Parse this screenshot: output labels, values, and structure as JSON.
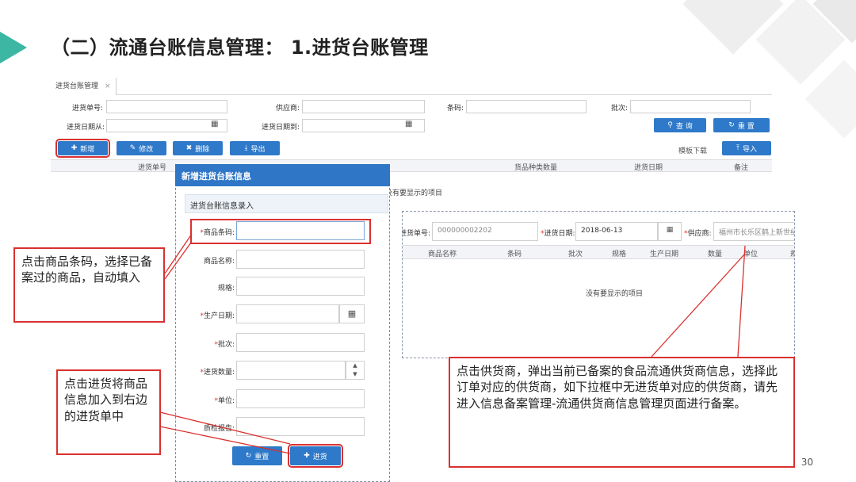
{
  "slide": {
    "title": "（二）流通台账信息管理： 1.进货台账管理",
    "page_number": "30"
  },
  "tab": {
    "label": "进货台账管理",
    "close": "×"
  },
  "search_form": {
    "order_no_label": "进货单号:",
    "supplier_label": "供应商:",
    "barcode_label": "条码:",
    "batch_label": "批次:",
    "date_from_label": "进货日期从:",
    "date_to_label": "进货日期到:",
    "query_button": "查 询",
    "reset_button": "重 置"
  },
  "toolbar": {
    "add": "新增",
    "edit": "修改",
    "delete": "删除",
    "export": "导出",
    "template_download": "模板下载",
    "import": "导入"
  },
  "grid": {
    "columns": [
      "进货单号",
      "货品种类数量",
      "进货日期",
      "备注"
    ],
    "empty_message": "没有要显示的项目"
  },
  "modal": {
    "title": "新增进货台账信息",
    "section_title": "进货台账信息录入",
    "fields": [
      {
        "label": "商品条码:",
        "required": "*"
      },
      {
        "label": "商品名称:",
        "required": ""
      },
      {
        "label": "规格:",
        "required": ""
      },
      {
        "label": "生产日期:",
        "required": "*"
      },
      {
        "label": "批次:",
        "required": "*"
      },
      {
        "label": "进货数量:",
        "required": "*"
      },
      {
        "label": "单位:",
        "required": "*"
      },
      {
        "label": "质检报告:",
        "required": ""
      }
    ],
    "reset_button": "重置",
    "submit_button": "进货"
  },
  "order_panel": {
    "order_no_label": "进货单号:",
    "order_no_value": "000000002202",
    "date_label": "进货日期:",
    "date_required": "*",
    "date_value": "2018-06-13",
    "supplier_label": "供应商:",
    "supplier_required": "*",
    "supplier_value": "福州市长乐区鹤上新世纪",
    "columns": [
      "商品名称",
      "条码",
      "批次",
      "规格",
      "生产日期",
      "数量",
      "单位",
      "规"
    ],
    "empty_message": "没有要显示的项目"
  },
  "callouts": {
    "barcode": "点击商品条码，选择已备案过的商品，自动填入",
    "submit": "点击进货将商品信息加入到右边的进货单中",
    "supplier": "点击供货商，弹出当前已备案的食品流通供货商信息，选择此订单对应的供货商，如下拉框中无进货单对应的供货商，请先进入信息备案管理-流通供货商信息管理页面进行备案。"
  },
  "colors": {
    "accent": "#2e79c9",
    "callout_border": "#d9312f",
    "slide_triangle": "#3bb7a3"
  },
  "icons": [
    "calendar-icon",
    "search-icon",
    "reset-icon",
    "plus-icon",
    "edit-icon",
    "delete-icon",
    "download-icon",
    "upload-icon",
    "spinner-icon"
  ]
}
